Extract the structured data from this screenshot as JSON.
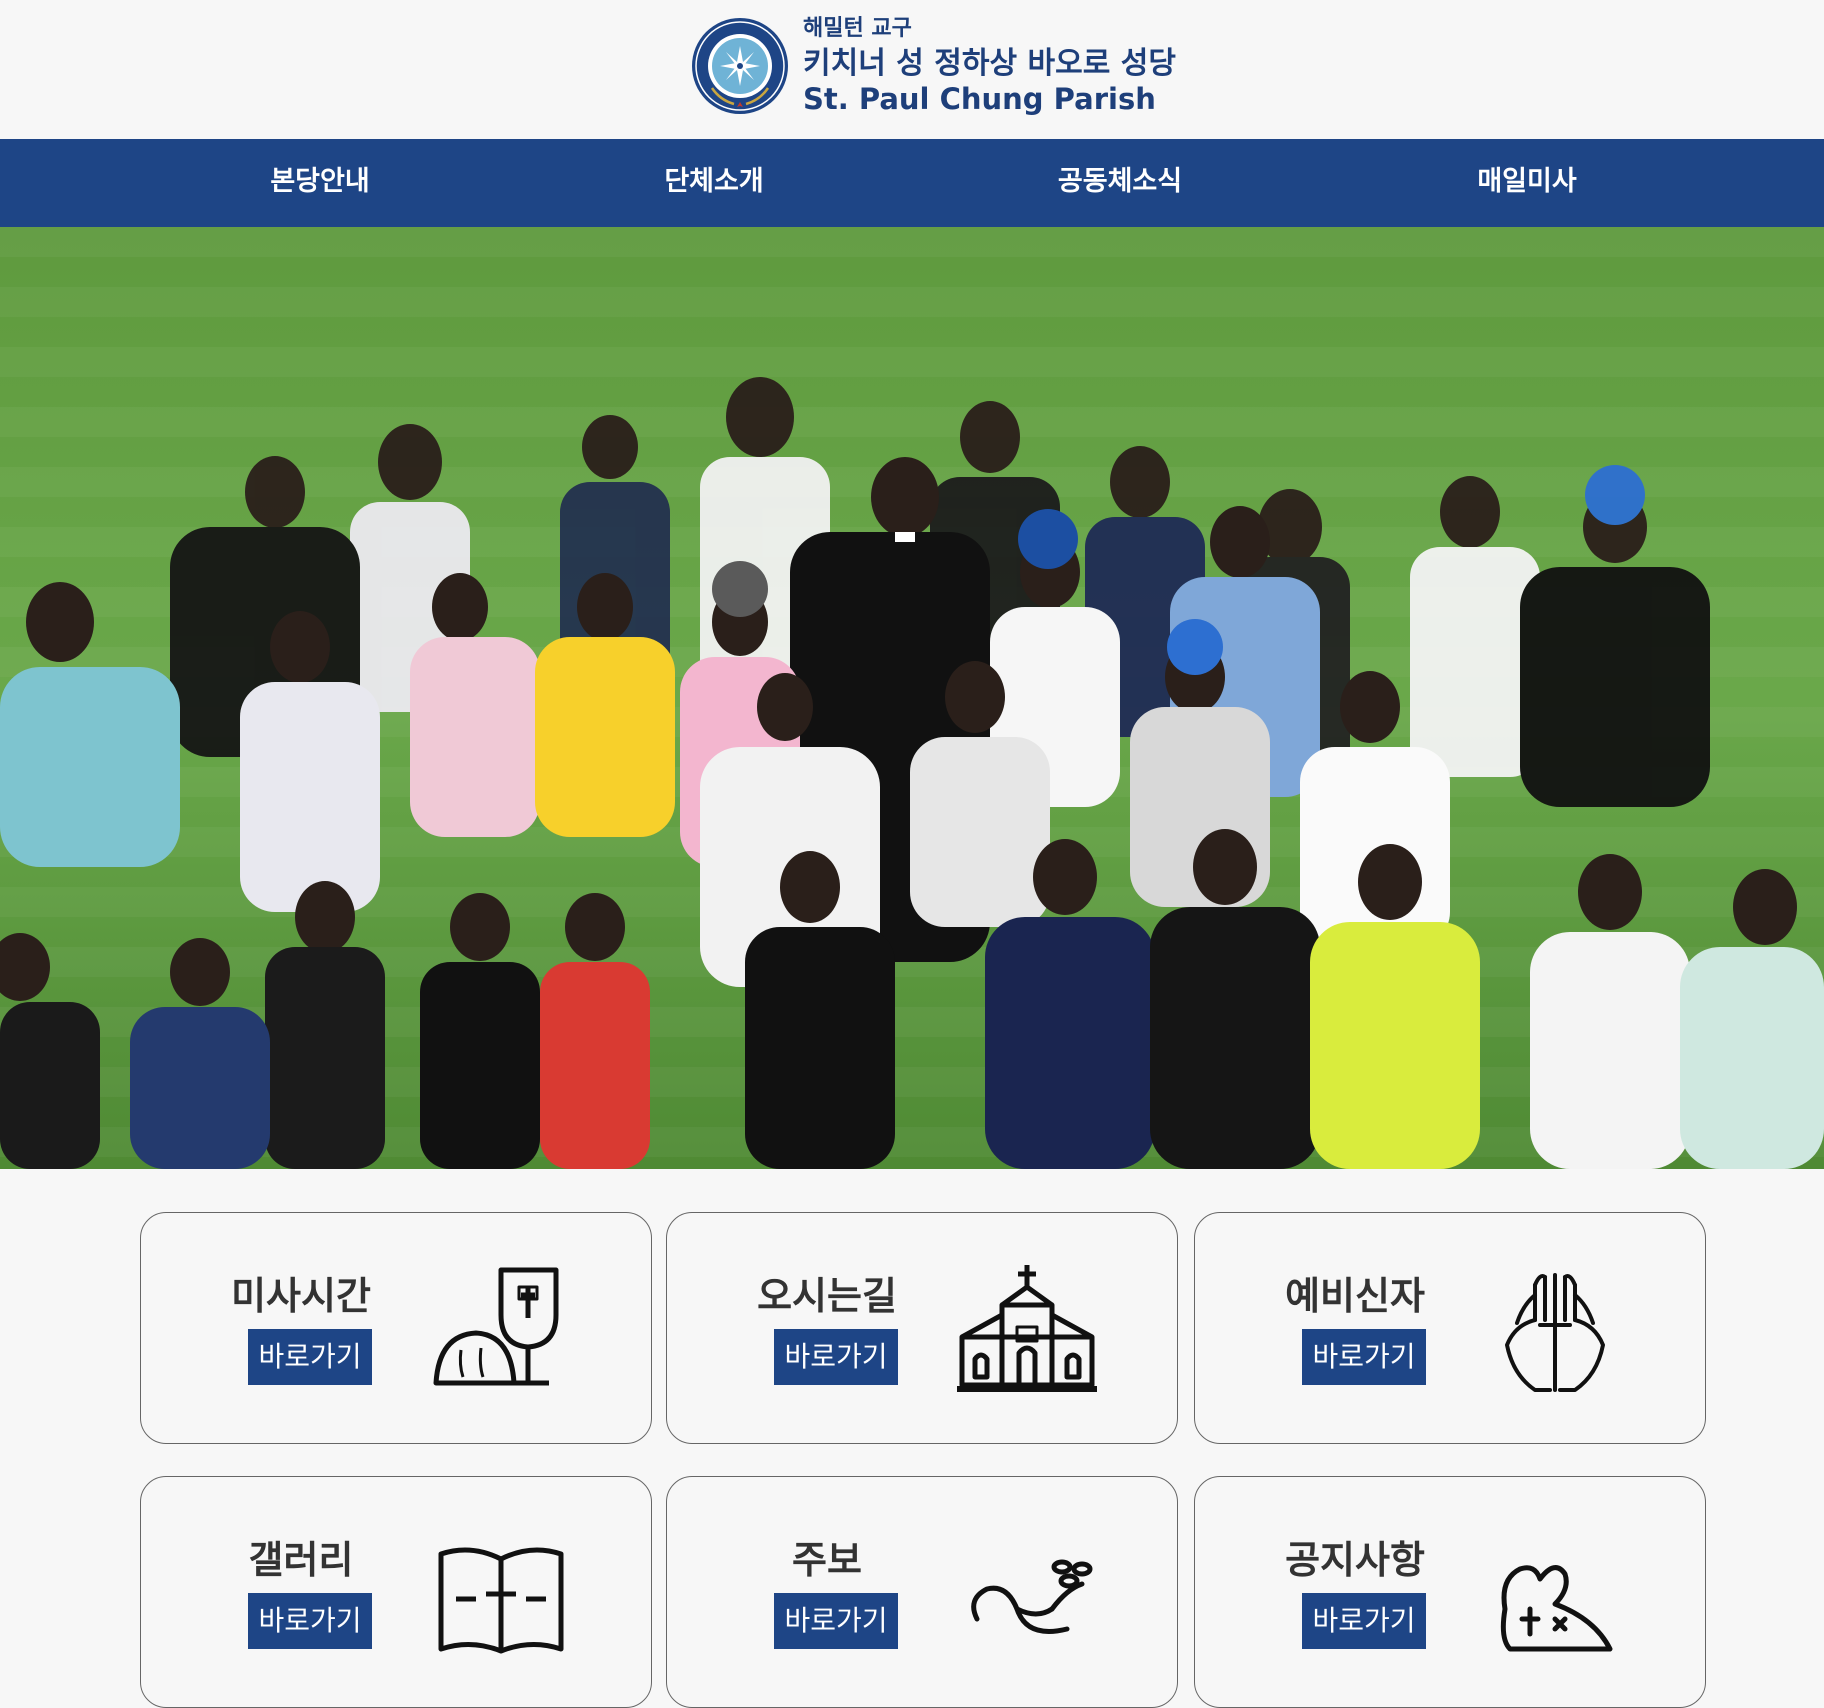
{
  "header": {
    "diocese": "해밀턴 교구",
    "parish_ko": "키치너 성 정하상 바오로 성당",
    "parish_en": "St. Paul Chung Parish",
    "logo_ring_text": "ST PAUL CHUNG PARISH"
  },
  "nav": {
    "items": [
      {
        "label": "본당안내"
      },
      {
        "label": "단체소개"
      },
      {
        "label": "공동체소식"
      },
      {
        "label": "매일미사"
      }
    ]
  },
  "cards": [
    {
      "title": "미사시간",
      "button": "바로가기",
      "icon": "chalice-bread-icon"
    },
    {
      "title": "오시는길",
      "button": "바로가기",
      "icon": "church-icon"
    },
    {
      "title": "예비신자",
      "button": "바로가기",
      "icon": "praying-hands-cross-icon"
    },
    {
      "title": "갤러리",
      "button": "바로가기",
      "icon": "open-bible-icon"
    },
    {
      "title": "주보",
      "button": "바로가기",
      "icon": "dove-olive-branch-icon"
    },
    {
      "title": "공지사항",
      "button": "바로가기",
      "icon": "announcement-icon"
    }
  ],
  "colors": {
    "brand_navy": "#1e4586",
    "text_navy": "#1e3f7a",
    "page_bg": "#f7f7f7"
  }
}
